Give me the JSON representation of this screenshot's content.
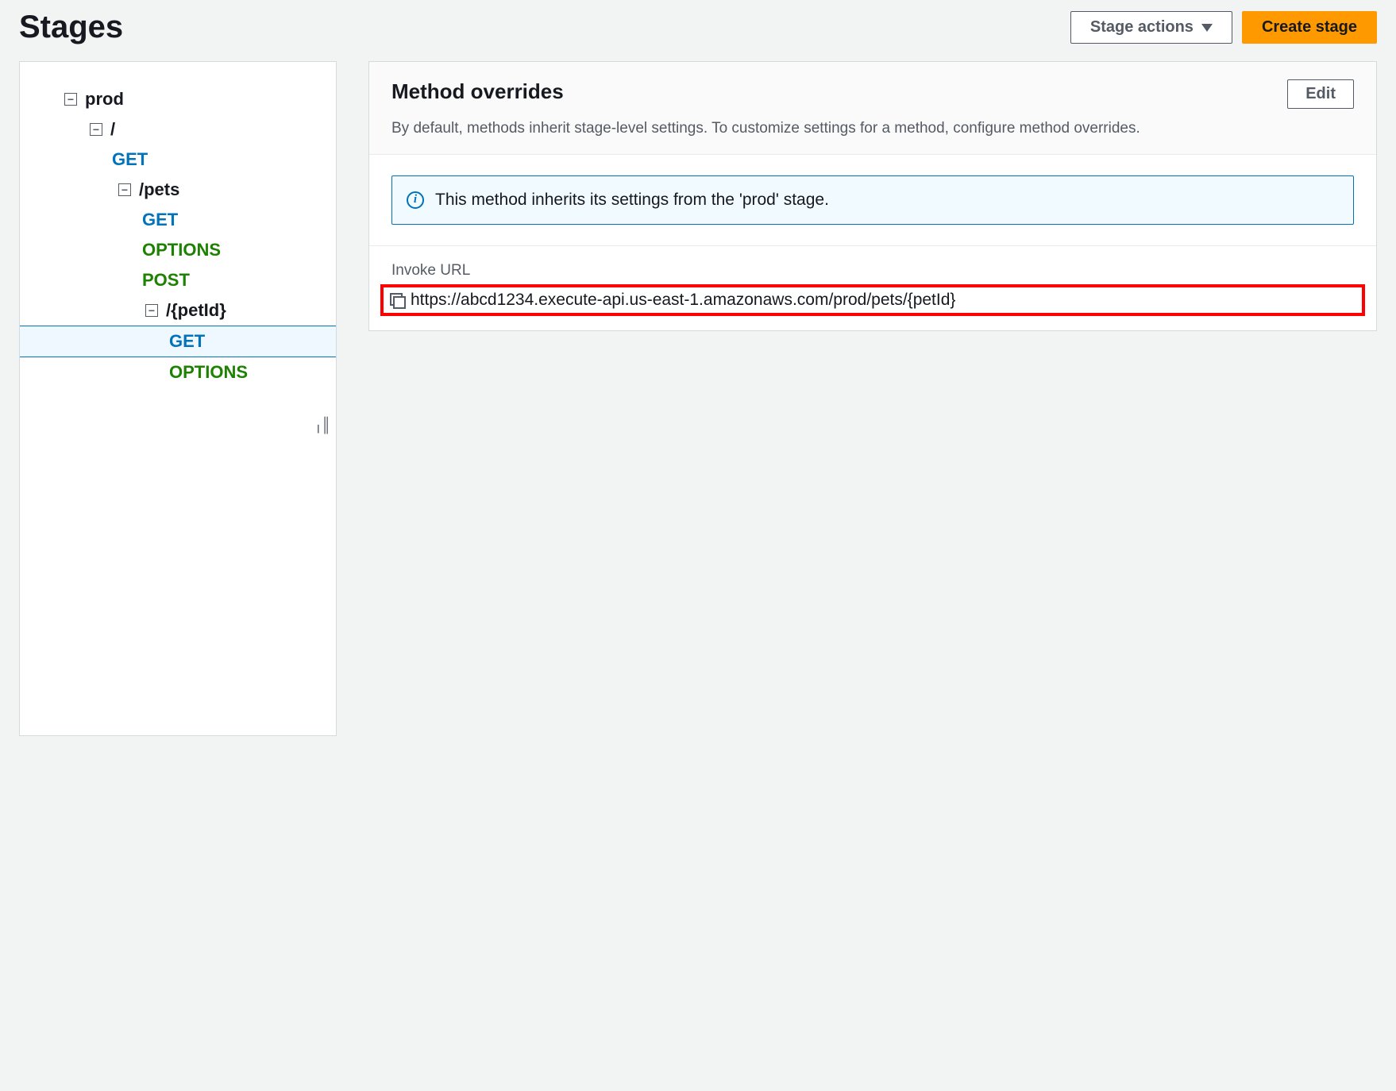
{
  "header": {
    "title": "Stages",
    "stage_actions_label": "Stage actions",
    "create_stage_label": "Create stage"
  },
  "tree": {
    "stage": "prod",
    "root_path": "/",
    "root_methods": [
      "GET"
    ],
    "pets_path": "/pets",
    "pets_methods": [
      "GET",
      "OPTIONS",
      "POST"
    ],
    "petid_path": "/{petId}",
    "petid_methods": [
      "GET",
      "OPTIONS"
    ],
    "selected_method": "GET"
  },
  "detail": {
    "title": "Method overrides",
    "description": "By default, methods inherit stage-level settings. To customize settings for a method, configure method overrides.",
    "edit_label": "Edit",
    "info_message": "This method inherits its settings from the 'prod' stage.",
    "invoke_label": "Invoke URL",
    "invoke_url": "https://abcd1234.execute-api.us-east-1.amazonaws.com/prod/pets/{petId}"
  }
}
